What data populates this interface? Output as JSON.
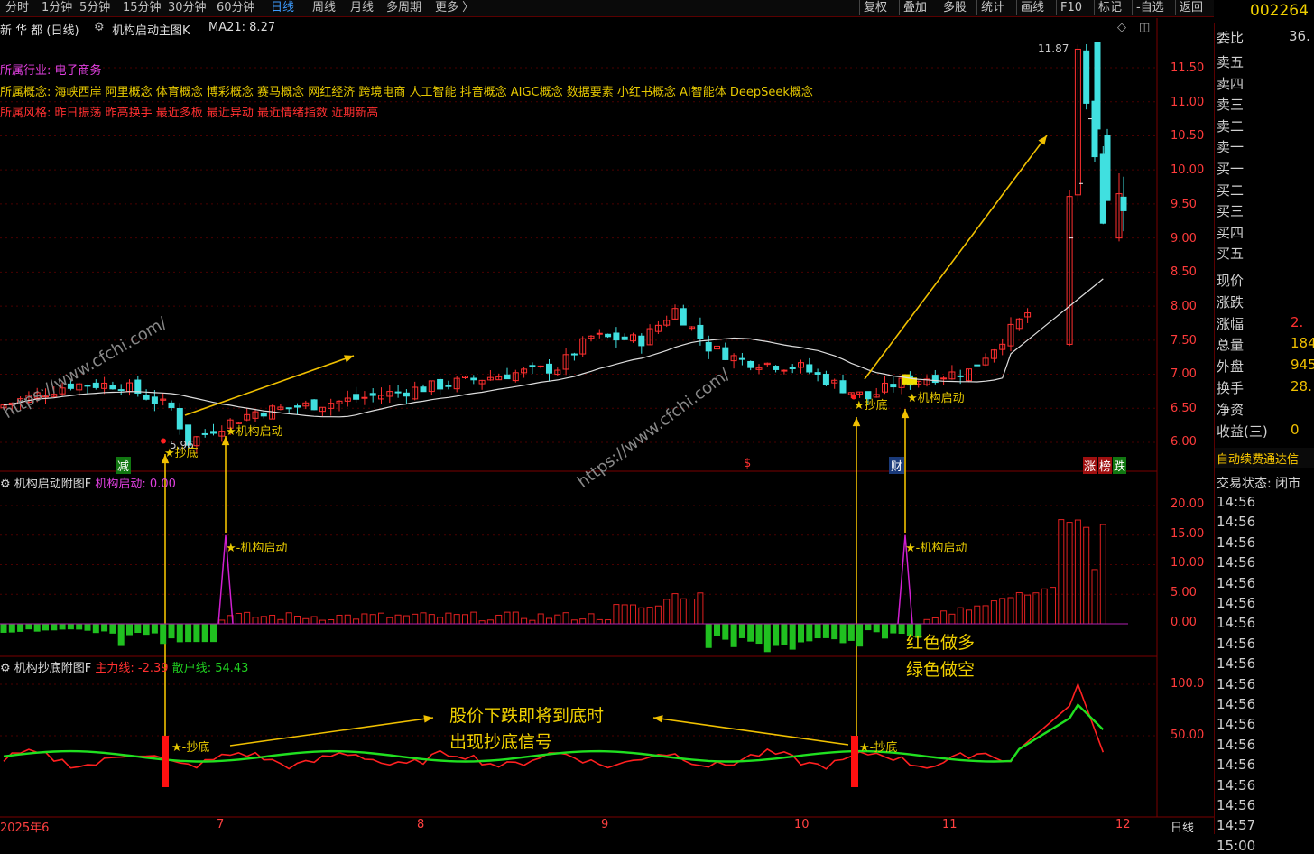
{
  "toolbar": {
    "periods": [
      "分时",
      "1分钟",
      "5分钟",
      "15分钟",
      "30分钟",
      "60分钟",
      "日线",
      "周线",
      "月线",
      "多周期",
      "更多 〉"
    ],
    "active_period": "日线",
    "right_buttons": [
      "复权",
      "叠加",
      "多股",
      "统计",
      "画线",
      "F10",
      "标记",
      "-自选",
      "返回"
    ],
    "stock_code": "002264"
  },
  "main_chart": {
    "title": "新 华 都 (日线)",
    "indicator_name": "机构启动主图K",
    "ma_label": "MA21: 8.27",
    "industry_label": "所属行业:",
    "industry_value": "电子商务",
    "concept_label": "所属概念:",
    "concept_value": "海峡西岸 阿里概念 体育概念 博彩概念 赛马概念 网红经济 跨境电商 人工智能 抖音概念 AIGC概念 数据要素 小红书概念 AI智能体 DeepSeek概念",
    "style_label": "所属风格:",
    "style_value": "昨日振荡 昨高换手 最近多板 最近异动 最近情绪指数 近期新高",
    "high_label": "11.87",
    "low_label": "5.96",
    "y_ticks": [
      "11.50",
      "11.00",
      "10.50",
      "10.00",
      "9.50",
      "9.00",
      "8.50",
      "8.00",
      "7.50",
      "7.00",
      "6.50",
      "6.00"
    ],
    "signals": [
      "★抄底",
      "★机构启动",
      "★抄底",
      "★机构启动"
    ],
    "markers": [
      "减",
      "$",
      "财",
      "涨",
      "榜",
      "跌"
    ],
    "watermark": "https://www.cfchi.com/"
  },
  "sub1": {
    "name": "机构启动附图F",
    "value_label": "机构启动: 0.00",
    "y_ticks": [
      "20.00",
      "15.00",
      "10.00",
      "5.00",
      "0.00"
    ],
    "signals": [
      "★-机构启动",
      "★-机构启动"
    ],
    "note_line1": "红色做多",
    "note_line2": "绿色做空"
  },
  "sub2": {
    "name": "机构抄底附图F",
    "main_line_label": "主力线: -2.39",
    "retail_line_label": "散户线: 54.43",
    "y_ticks": [
      "100.0",
      "50.00"
    ],
    "signals": [
      "★-抄底",
      "★-抄底"
    ],
    "note_line1": "股价下跌即将到底时",
    "note_line2": "出现抄底信号"
  },
  "x_axis": {
    "labels": [
      "2025年6",
      "7",
      "8",
      "9",
      "10",
      "11",
      "12"
    ],
    "period_label": "日线"
  },
  "quote_panel": {
    "wei_bi_label": "委比",
    "wei_bi_value": "36.",
    "sell_levels": [
      "卖五",
      "卖四",
      "卖三",
      "卖二",
      "卖一"
    ],
    "buy_levels": [
      "买一",
      "买二",
      "买三",
      "买四",
      "买五"
    ],
    "stats": [
      {
        "label": "现价",
        "value": ""
      },
      {
        "label": "涨跌",
        "value": ""
      },
      {
        "label": "涨幅",
        "value": "2."
      },
      {
        "label": "总量",
        "value": "184"
      },
      {
        "label": "外盘",
        "value": "945"
      },
      {
        "label": "换手",
        "value": "28."
      },
      {
        "label": "净资",
        "value": ""
      },
      {
        "label": "收益(三)",
        "value": "0"
      }
    ],
    "auto_renew": "自动续费通达信",
    "trade_status": "交易状态: 闭市",
    "times": [
      "14:56",
      "14:56",
      "14:56",
      "14:56",
      "14:56",
      "14:56",
      "14:56",
      "14:56",
      "14:56",
      "14:56",
      "14:56",
      "14:56",
      "14:56",
      "14:56",
      "14:56",
      "14:56",
      "14:57",
      "15:00"
    ]
  },
  "colors": {
    "up": "#ff3030",
    "down": "#40e0e0",
    "ma": "#dddddd",
    "signal": "#f0c000",
    "macd_up": "#e02020",
    "macd_down": "#20c020",
    "retail": "#20e020",
    "main": "#ff2020"
  },
  "chart_data": {
    "type": "candlestick",
    "price_axis": [
      6.0,
      11.5
    ],
    "ma21_last": 8.27,
    "high": 11.87,
    "low": 5.96,
    "sub1_axis": [
      0,
      20
    ],
    "sub2_axis": [
      50,
      100
    ]
  }
}
